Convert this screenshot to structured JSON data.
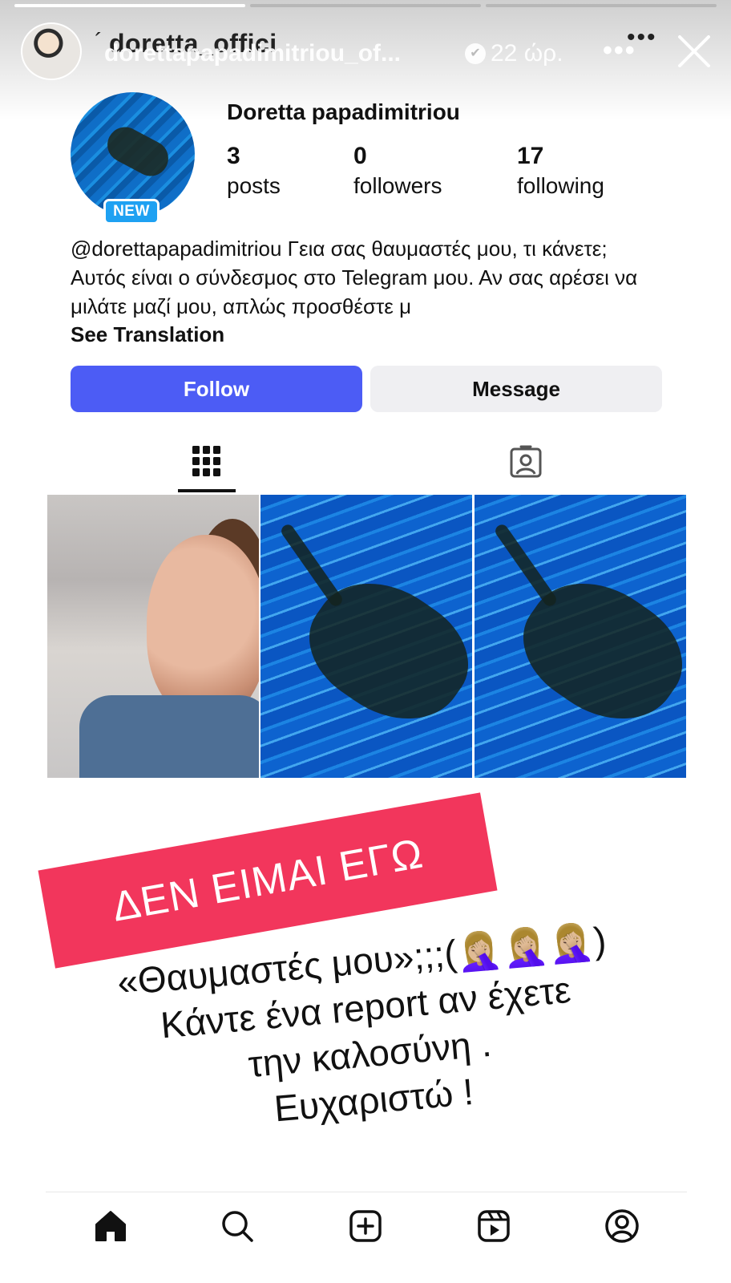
{
  "story": {
    "progress": [
      1.0,
      0.0,
      0.0
    ],
    "underlay_name": "doretta_offici",
    "username": "dorettapapadimitriou_of...",
    "time": "22 ώρ.",
    "more_label": "•••",
    "close_icon": "close-icon"
  },
  "profile": {
    "name": "Doretta papadimitriou",
    "badge": "NEW",
    "stats": [
      {
        "value": "3",
        "label": "posts"
      },
      {
        "value": "0",
        "label": "followers"
      },
      {
        "value": "17",
        "label": "following"
      }
    ],
    "bio": "@dorettapapadimitriou Γεια σας θαυμαστές μου, τι κάνετε; Αυτός είναι ο σύνδεσμος στο Telegram μου. Αν σας αρέσει να μιλάτε μαζί μου, απλώς προσθέστε μ",
    "see_translation": "See Translation",
    "follow_label": "Follow",
    "message_label": "Message"
  },
  "tabs": [
    {
      "icon": "grid-icon",
      "active": true
    },
    {
      "icon": "tagged-icon",
      "active": false
    }
  ],
  "posts": [
    "portrait",
    "pool",
    "pool"
  ],
  "overlay": {
    "banner": "ΔΕΝ ΕΙΜΑΙ ΕΓΩ",
    "lines": [
      "«Θαυμαστές μου»;;;(🤦🏼‍♀️🤦🏼‍♀️🤦🏼‍♀️)",
      "Κάντε ένα report αν έχετε",
      "την καλοσύνη .",
      "Ευχαριστώ !"
    ]
  },
  "bottom_nav": [
    "home-icon",
    "search-icon",
    "create-icon",
    "reels-icon",
    "profile-icon"
  ],
  "colors": {
    "follow": "#4c5cf5",
    "banner": "#f2365c",
    "badge": "#1ea1f2"
  }
}
